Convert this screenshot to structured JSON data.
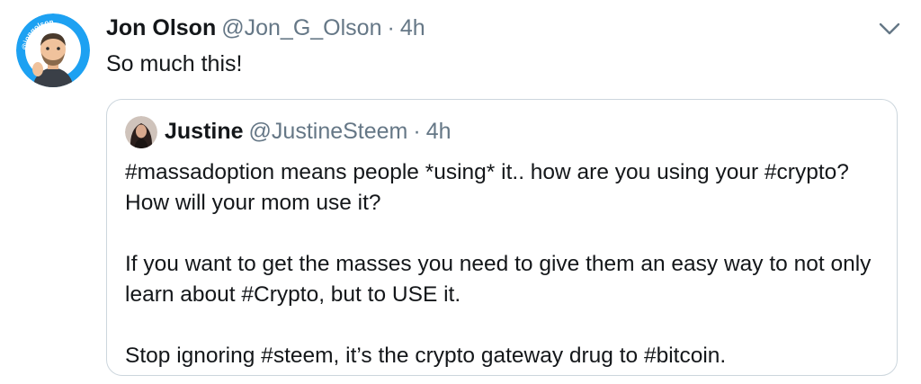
{
  "tweet": {
    "author_name": "Jon Olson",
    "author_handle": "@Jon_G_Olson",
    "separator": "·",
    "time": "4h",
    "text": "So much this!",
    "avatar_icon": "avatar-cartoon-portrait",
    "avatar_ring_text": "@jongolson",
    "menu_icon": "chevron-down-icon"
  },
  "quoted": {
    "author_name": "Justine",
    "author_handle": "@JustineSteem",
    "separator": "·",
    "time": "4h",
    "avatar_icon": "avatar-photo",
    "paragraphs": [
      "#massadoption means people *using* it.. how are you using your #crypto? How will your mom use it?",
      "If you want to get the masses you need to give them an easy way to not only learn about #Crypto, but to USE it.",
      "Stop ignoring #steem, it’s the crypto gateway drug to #bitcoin."
    ]
  },
  "colors": {
    "text_primary": "#14171a",
    "text_secondary": "#657786",
    "border": "#ccd6dd",
    "avatar_ring": "#1da1f2"
  }
}
